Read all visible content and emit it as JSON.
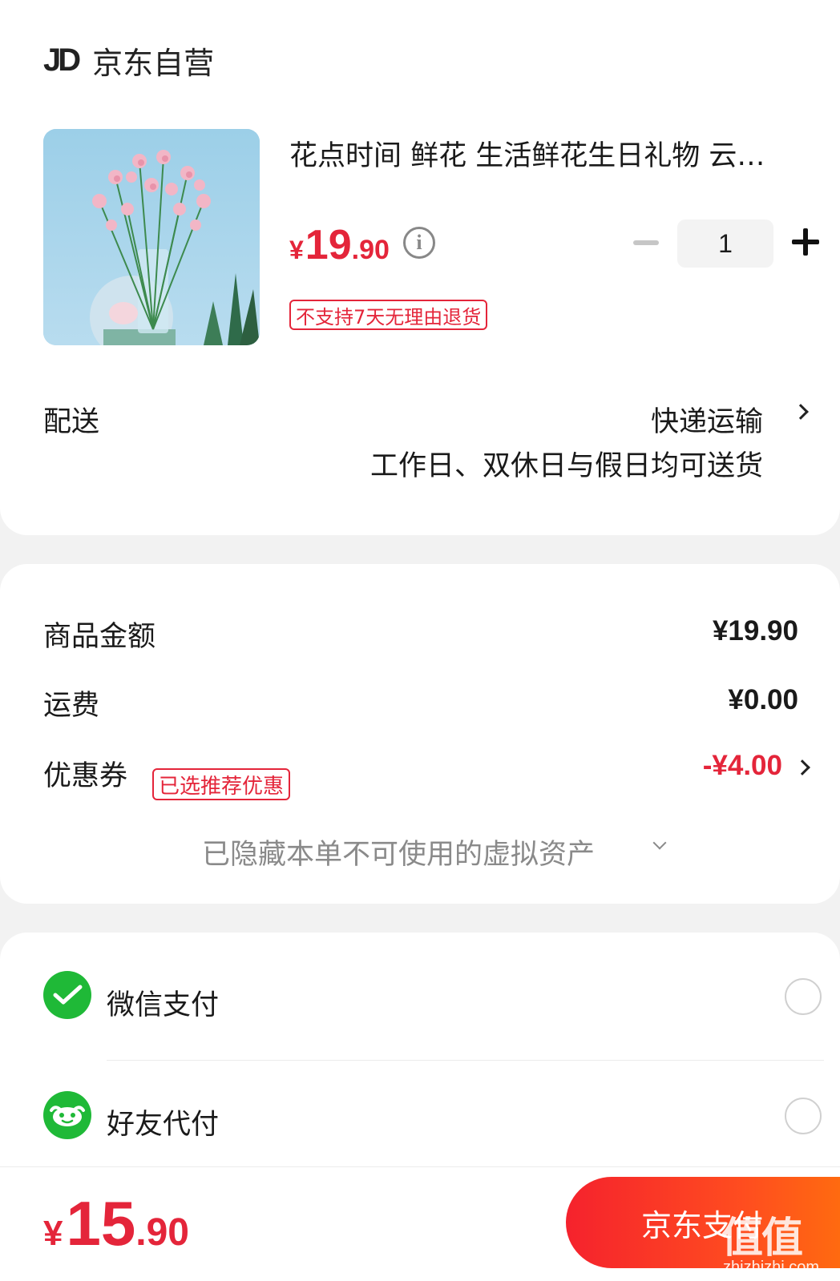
{
  "store": {
    "logo": "JD",
    "name": "京东自营"
  },
  "product": {
    "title": "花点时间 鲜花 生活鲜花生日礼物 云…",
    "price": {
      "symbol": "¥",
      "integer": "19",
      "decimal": ".90"
    },
    "quantity": "1",
    "return_policy_tag": "不支持7天无理由退货",
    "image_icon": "flower-vase-image"
  },
  "delivery": {
    "label": "配送",
    "method": "快递运输",
    "note": "工作日、双休日与假日均可送货"
  },
  "summary": {
    "rows": [
      {
        "label": "商品金额",
        "value": "¥19.90"
      },
      {
        "label": "运费",
        "value": "¥0.00"
      },
      {
        "label": "优惠券",
        "value": "-¥4.00",
        "tag": "已选推荐优惠"
      }
    ],
    "hidden_assets_text": "已隐藏本单不可使用的虚拟资产"
  },
  "payment": {
    "options": [
      {
        "label": "微信支付",
        "icon": "wechat-pay-icon"
      },
      {
        "label": "好友代付",
        "icon": "friend-pay-icon"
      }
    ]
  },
  "checkout": {
    "total": {
      "symbol": "¥",
      "integer": "15",
      "decimal": ".90"
    },
    "button_label": "京东支付",
    "watermark": "值值值",
    "watermark_url": "zhizhizhi.com"
  },
  "colors": {
    "accent": "#e4253a",
    "wechat_green": "#1fb937",
    "background": "#f2f2f2"
  }
}
